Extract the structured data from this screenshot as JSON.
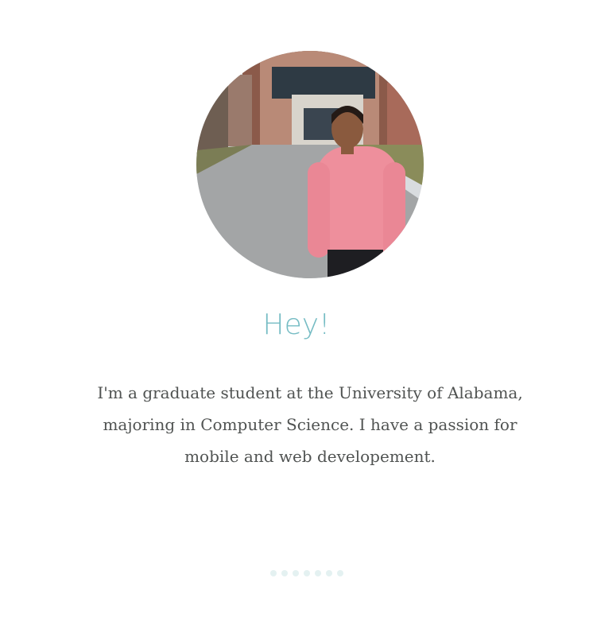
{
  "profile": {
    "photo_alt": "Photo in front of a university building"
  },
  "intro": {
    "heading": "Hey!",
    "bio": "I'm a graduate student at the University of Alabama, majoring in Computer Science. I have a passion for mobile and web developement."
  },
  "pagination": {
    "count": 7,
    "active_index": 0
  },
  "colors": {
    "heading": "#76bcc4",
    "body_text": "#505352",
    "dot": "#e4f1f1"
  }
}
